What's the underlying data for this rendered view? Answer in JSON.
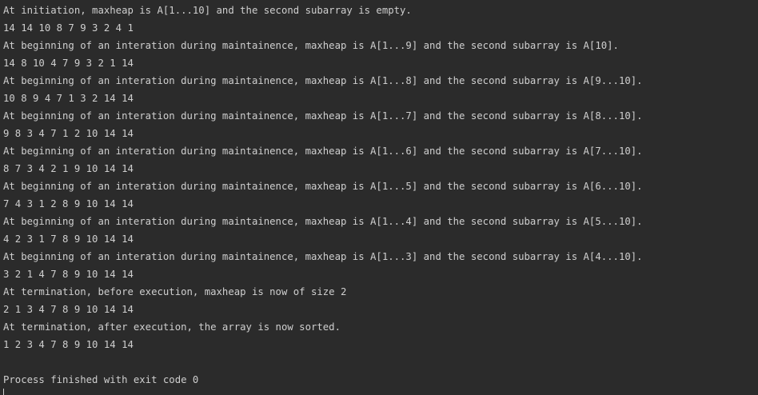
{
  "console": {
    "lines": [
      "At initiation, maxheap is A[1...10] and the second subarray is empty.",
      "14 14 10 8 7 9 3 2 4 1",
      "At beginning of an interation during maintainence, maxheap is A[1...9] and the second subarray is A[10].",
      "14 8 10 4 7 9 3 2 1 14",
      "At beginning of an interation during maintainence, maxheap is A[1...8] and the second subarray is A[9...10].",
      "10 8 9 4 7 1 3 2 14 14",
      "At beginning of an interation during maintainence, maxheap is A[1...7] and the second subarray is A[8...10].",
      "9 8 3 4 7 1 2 10 14 14",
      "At beginning of an interation during maintainence, maxheap is A[1...6] and the second subarray is A[7...10].",
      "8 7 3 4 2 1 9 10 14 14",
      "At beginning of an interation during maintainence, maxheap is A[1...5] and the second subarray is A[6...10].",
      "7 4 3 1 2 8 9 10 14 14",
      "At beginning of an interation during maintainence, maxheap is A[1...4] and the second subarray is A[5...10].",
      "4 2 3 1 7 8 9 10 14 14",
      "At beginning of an interation during maintainence, maxheap is A[1...3] and the second subarray is A[4...10].",
      "3 2 1 4 7 8 9 10 14 14",
      "At termination, before execution, maxheap is now of size 2",
      "2 1 3 4 7 8 9 10 14 14",
      "At termination, after execution, the array is now sorted.",
      "1 2 3 4 7 8 9 10 14 14",
      "",
      "Process finished with exit code 0"
    ]
  },
  "colors": {
    "background": "#2b2b2b",
    "text": "#cfcfcf"
  }
}
